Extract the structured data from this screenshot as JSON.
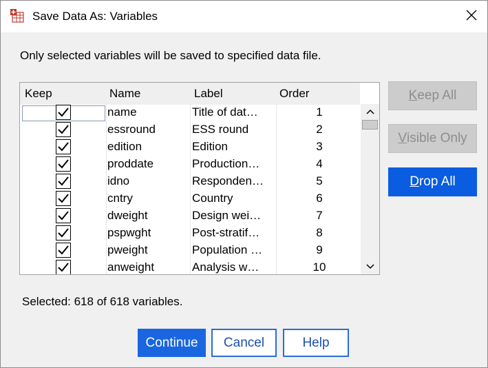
{
  "window": {
    "title": "Save Data As: Variables"
  },
  "instruction": "Only selected variables will be saved to specified data file.",
  "table": {
    "headers": {
      "keep": "Keep",
      "name": "Name",
      "label": "Label",
      "order": "Order"
    },
    "rows": [
      {
        "keep": true,
        "name": "name",
        "label": "Title of dat…",
        "order": "1"
      },
      {
        "keep": true,
        "name": "essround",
        "label": "ESS round",
        "order": "2"
      },
      {
        "keep": true,
        "name": "edition",
        "label": "Edition",
        "order": "3"
      },
      {
        "keep": true,
        "name": "proddate",
        "label": "Production…",
        "order": "4"
      },
      {
        "keep": true,
        "name": "idno",
        "label": "Responden…",
        "order": "5"
      },
      {
        "keep": true,
        "name": "cntry",
        "label": "Country",
        "order": "6"
      },
      {
        "keep": true,
        "name": "dweight",
        "label": "Design wei…",
        "order": "7"
      },
      {
        "keep": true,
        "name": "pspwght",
        "label": "Post-stratif…",
        "order": "8"
      },
      {
        "keep": true,
        "name": "pweight",
        "label": "Population …",
        "order": "9"
      },
      {
        "keep": true,
        "name": "anweight",
        "label": "Analysis w…",
        "order": "10"
      }
    ]
  },
  "side_buttons": {
    "keep_all": {
      "label_mnemonic": "K",
      "label_rest": "eep All",
      "enabled": false
    },
    "visible_only": {
      "label_mnemonic": "V",
      "label_rest": "isible Only",
      "enabled": false
    },
    "drop_all": {
      "label_mnemonic": "D",
      "label_rest": "rop All",
      "enabled": true
    }
  },
  "status": {
    "selected": "Selected: 618 of 618 variables."
  },
  "footer": {
    "continue": "Continue",
    "cancel": "Cancel",
    "help": "Help"
  },
  "colors": {
    "primary": "#1a66e0",
    "disabled": "#cccccc"
  },
  "icons": {
    "app": "spss-data-icon",
    "close": "close-icon",
    "check": "checkmark-icon"
  }
}
